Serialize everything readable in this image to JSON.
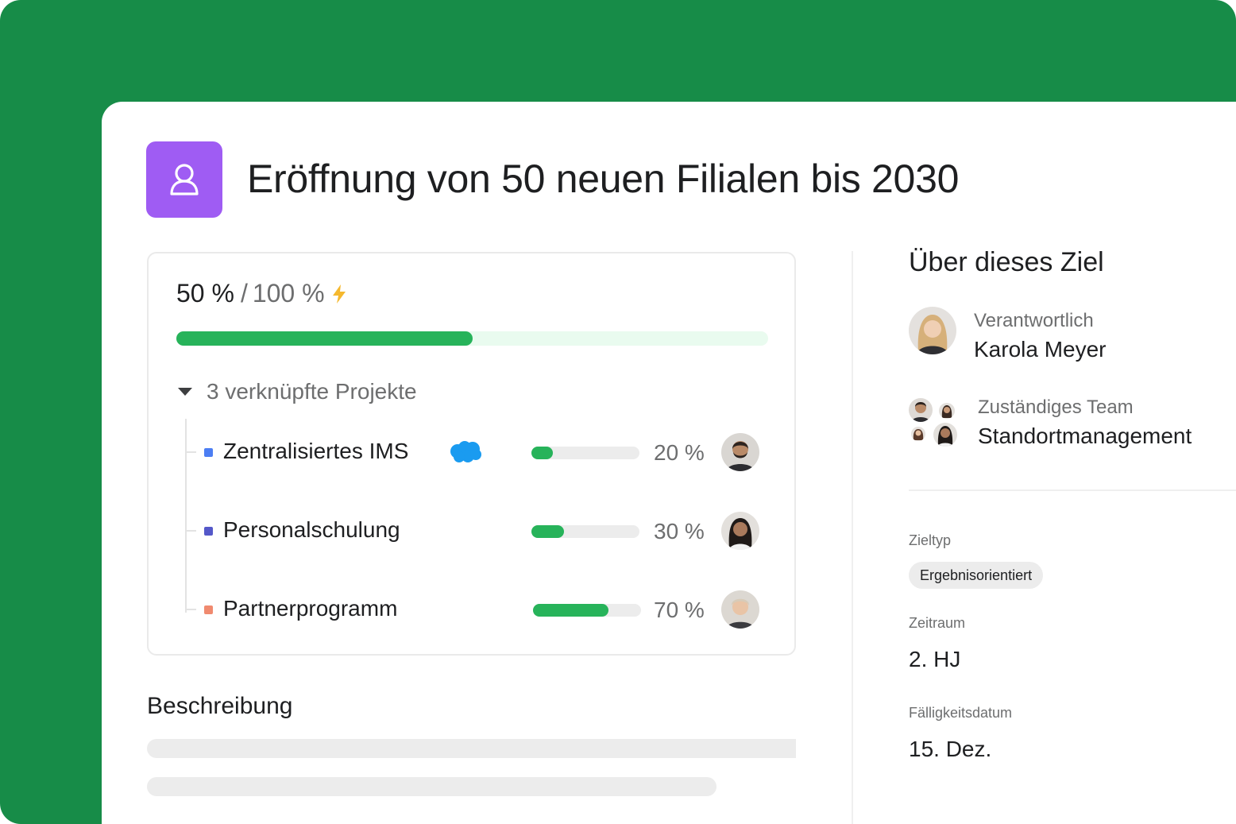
{
  "goal": {
    "title": "Eröffnung von 50 neuen Filialen bis 2030",
    "icon": "person-icon",
    "icon_color": "#9F5CF3"
  },
  "progress": {
    "current": "50 %",
    "separator": "/",
    "target": "100 %",
    "fraction": 0.5,
    "bar_color": "#27B35A"
  },
  "projects": {
    "toggle_label": "3 verknüpfte Projekte",
    "items": [
      {
        "name": "Zentralisiertes IMS",
        "dot_color": "#4C7EF3",
        "percent": "20 %",
        "fraction": 0.2,
        "integration": "salesforce-cloud-icon"
      },
      {
        "name": "Personalschulung",
        "dot_color": "#5458C9",
        "percent": "30 %",
        "fraction": 0.3
      },
      {
        "name": "Partnerprogramm",
        "dot_color": "#F08A6F",
        "percent": "70 %",
        "fraction": 0.7
      }
    ]
  },
  "description": {
    "heading": "Beschreibung"
  },
  "about": {
    "heading": "Über dieses Ziel",
    "owner_label": "Verantwortlich",
    "owner_name": "Karola Meyer",
    "team_label": "Zuständiges Team",
    "team_name": "Standortmanagement",
    "goal_type_label": "Zieltyp",
    "goal_type_value": "Ergebnisorientiert",
    "period_label": "Zeitraum",
    "period_value": "2. HJ",
    "due_label": "Fälligkeitsdatum",
    "due_value": "15. Dez."
  },
  "colors": {
    "brand_green": "#178C48",
    "progress_green": "#27B35A"
  }
}
